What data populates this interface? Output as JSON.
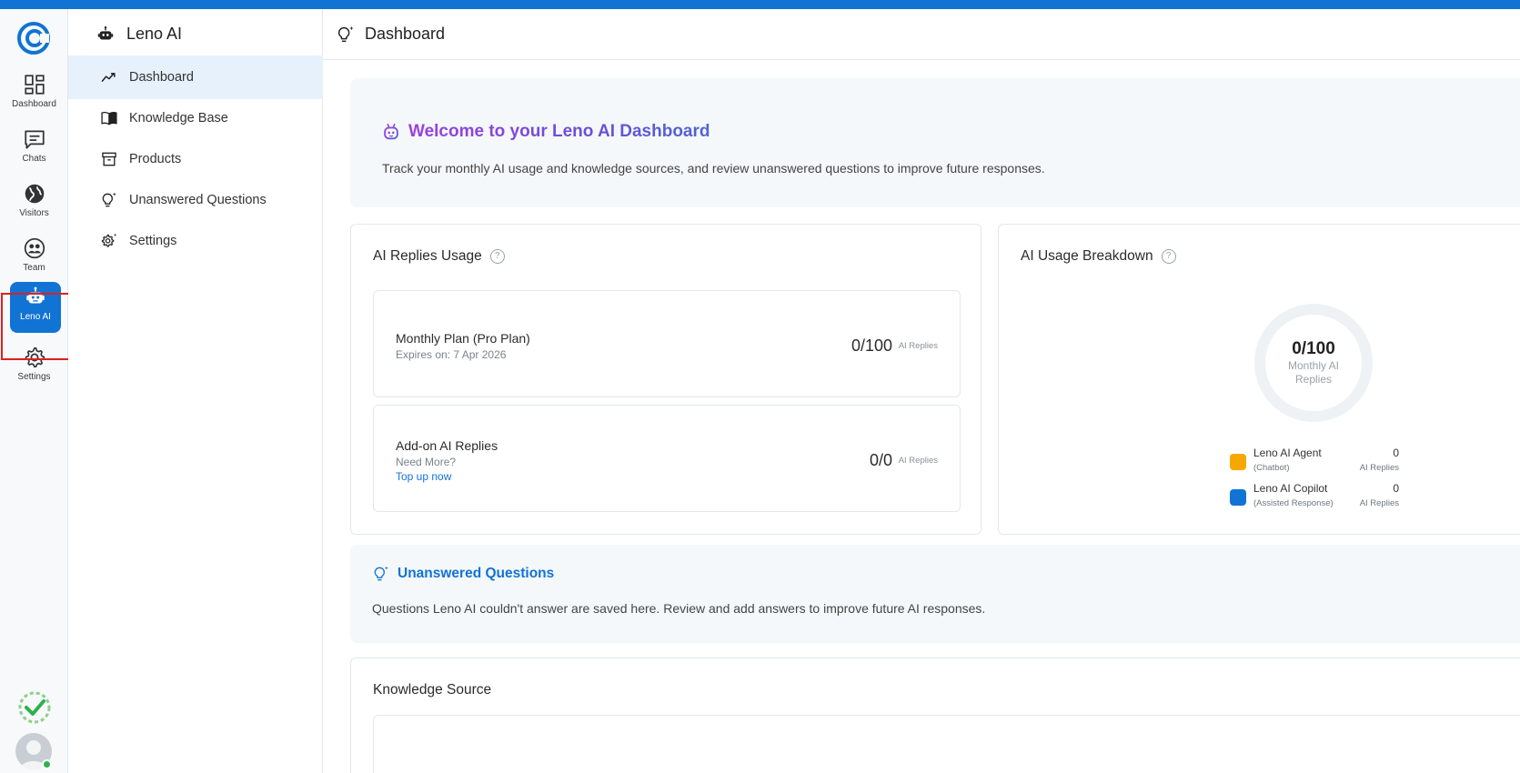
{
  "rail": {
    "items": [
      {
        "label": "Dashboard"
      },
      {
        "label": "Chats"
      },
      {
        "label": "Visitors"
      },
      {
        "label": "Team"
      },
      {
        "label": "Leno AI"
      },
      {
        "label": "Settings"
      }
    ],
    "active": "Leno AI"
  },
  "sidenav": {
    "title": "Leno AI",
    "items": [
      {
        "label": "Dashboard"
      },
      {
        "label": "Knowledge Base"
      },
      {
        "label": "Products"
      },
      {
        "label": "Unanswered Questions"
      },
      {
        "label": "Settings"
      }
    ],
    "active": "Dashboard"
  },
  "main": {
    "title": "Dashboard",
    "welcome": {
      "title": "Welcome to your Leno AI Dashboard",
      "description": "Track your monthly AI usage and knowledge sources, and review unanswered questions to improve future responses."
    },
    "usage": {
      "title": "AI Replies Usage",
      "help": "?",
      "plan": {
        "name": "Monthly Plan (Pro Plan)",
        "expires": "Expires on: 7 Apr 2026",
        "count": "0/100",
        "unit": "AI Replies"
      },
      "addon": {
        "name": "Add-on AI Replies",
        "sub": "Need More?",
        "link": "Top up now",
        "count": "0/0",
        "unit": "AI Replies"
      }
    },
    "breakdown": {
      "title": "AI Usage Breakdown",
      "help": "?",
      "center_value": "0/100",
      "center_label": "Monthly AI Replies",
      "used_fraction": 0,
      "legend": [
        {
          "name": "Leno AI Agent",
          "sub": "(Chatbot)",
          "value": "0",
          "unit": "AI Replies",
          "color": "#f6a800"
        },
        {
          "name": "Leno AI Copilot",
          "sub": "(Assisted Response)",
          "value": "0",
          "unit": "AI Replies",
          "color": "#1173d4"
        }
      ]
    },
    "unanswered": {
      "title": "Unanswered Questions",
      "description": "Questions Leno AI couldn't answer are saved here. Review and add answers to improve future AI responses."
    },
    "knowledge": {
      "title": "Knowledge Source"
    }
  },
  "colors": {
    "accent": "#1173d4",
    "active_nav_bg": "#e6f1fc",
    "highlight": "#e0201e",
    "donut_track": "#eef2f5"
  }
}
